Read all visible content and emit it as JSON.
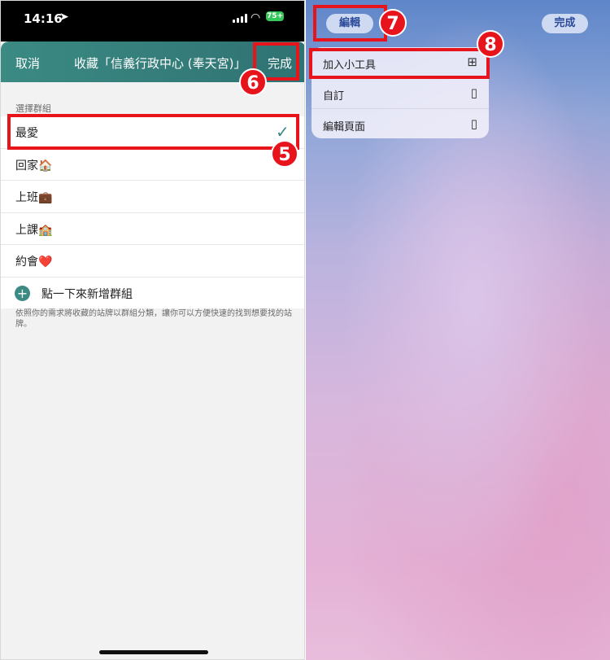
{
  "left": {
    "status": {
      "time": "14:16",
      "battery": "75+"
    },
    "nav": {
      "cancel": "取消",
      "title": "收藏「信義行政中心 (奉天宮)」",
      "done": "完成"
    },
    "section_label": "選擇群組",
    "groups": [
      {
        "label": "最愛",
        "emoji": "",
        "selected": true
      },
      {
        "label": "回家",
        "emoji": "🏠",
        "selected": false
      },
      {
        "label": "上班",
        "emoji": "💼",
        "selected": false
      },
      {
        "label": "上課",
        "emoji": "🏫",
        "selected": false
      },
      {
        "label": "約會",
        "emoji": "❤️",
        "selected": false
      }
    ],
    "add_group": "點一下來新增群組",
    "footnote": "依照你的需求將收藏的站牌以群組分類，讓你可以方便快速的找到想要找的站牌。"
  },
  "right": {
    "edit_button": "編輯",
    "done_button": "完成",
    "menu": [
      {
        "label": "加入小工具",
        "icon": "add-widget-icon"
      },
      {
        "label": "自訂",
        "icon": "customize-icon"
      },
      {
        "label": "編輯頁面",
        "icon": "edit-pages-icon"
      }
    ]
  },
  "annotations": [
    "5",
    "6",
    "7",
    "8"
  ],
  "colors": {
    "accent_teal": "#3b8a83",
    "highlight_red": "#e8141c"
  }
}
